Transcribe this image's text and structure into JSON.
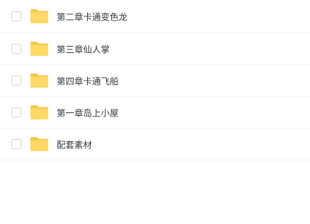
{
  "file_list": {
    "items": [
      {
        "name": "第二章卡通变色龙",
        "icon": "folder-icon",
        "checked": false
      },
      {
        "name": "第三章仙人掌",
        "icon": "folder-icon",
        "checked": false
      },
      {
        "name": "第四章卡通飞船",
        "icon": "folder-icon",
        "checked": false
      },
      {
        "name": "第一章岛上小屋",
        "icon": "folder-icon",
        "checked": false
      },
      {
        "name": "配套素材",
        "icon": "folder-icon",
        "checked": false
      }
    ]
  },
  "colors": {
    "folder_back": "#f9c747",
    "folder_front": "#ffd966",
    "text": "#333740",
    "divider": "#f1f2f4",
    "checkbox_border": "#cfd3d9"
  }
}
